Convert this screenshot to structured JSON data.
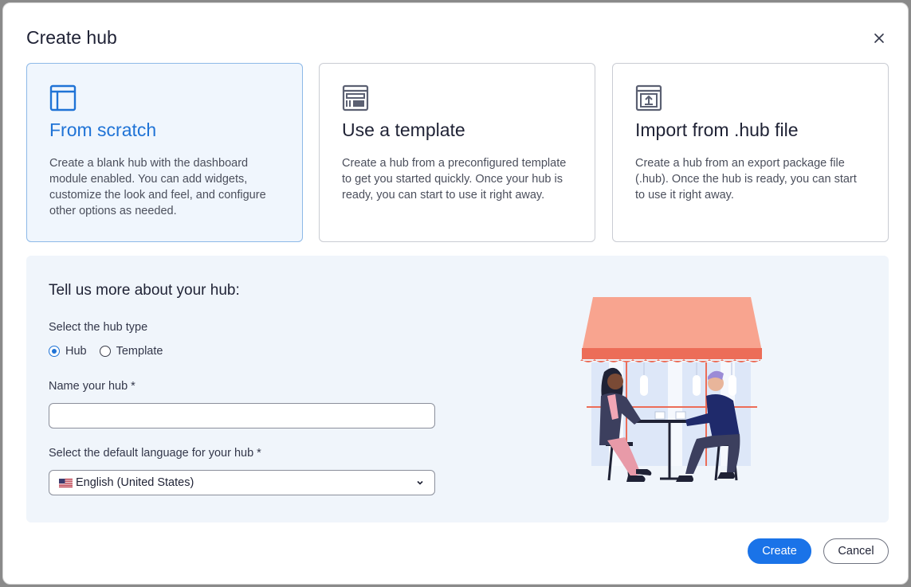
{
  "dialog": {
    "title": "Create hub",
    "close_icon": "close-icon"
  },
  "cards": [
    {
      "title": "From scratch",
      "description": "Create a blank hub with the dashboard module enabled. You can add widgets, customize the look and feel, and configure other options as needed.",
      "icon": "layout-icon",
      "selected": true
    },
    {
      "title": "Use a template",
      "description": "Create a hub from a preconfigured template to get you started quickly. Once your hub is ready, you can start to use it right away.",
      "icon": "template-icon",
      "selected": false
    },
    {
      "title": "Import from .hub file",
      "description": "Create a hub from an export package file (.hub). Once the hub is ready, you can start to use it right away.",
      "icon": "import-icon",
      "selected": false
    }
  ],
  "form": {
    "heading": "Tell us more about your hub:",
    "hub_type_label": "Select the hub type",
    "hub_type_options": [
      "Hub",
      "Template"
    ],
    "hub_type_selected": "Hub",
    "name_label": "Name your hub *",
    "name_value": "",
    "language_label": "Select the default language for your hub *",
    "language_value": "English (United States)",
    "language_flag_icon": "us-flag-icon"
  },
  "footer": {
    "create_label": "Create",
    "cancel_label": "Cancel"
  },
  "colors": {
    "accent": "#1a73e8",
    "selected_card_bg": "#f0f6fd",
    "panel_bg": "#f0f5fb",
    "awning": "#f8a48f"
  }
}
